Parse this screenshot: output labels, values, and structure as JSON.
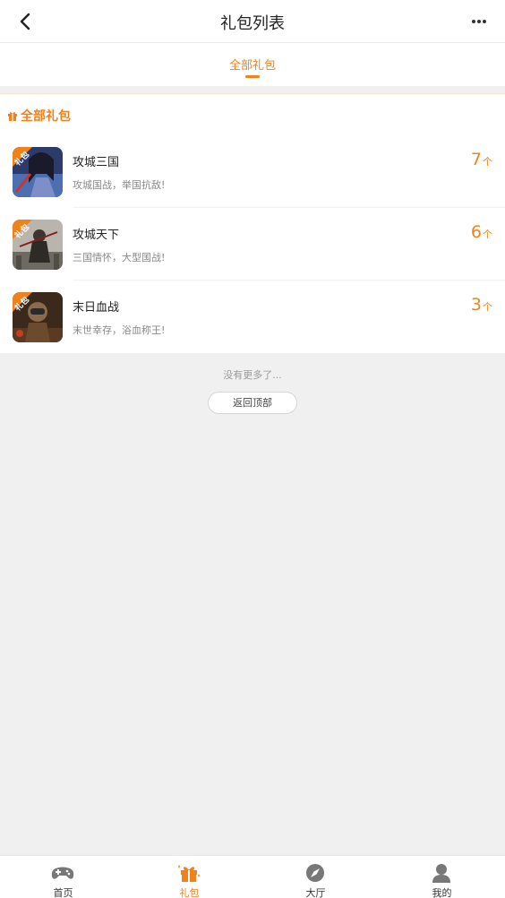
{
  "header": {
    "title": "礼包列表"
  },
  "tabs": [
    {
      "label": "全部礼包"
    }
  ],
  "section": {
    "title": "全部礼包"
  },
  "games": [
    {
      "name": "攻城三国",
      "desc": "攻城国战，举国抗敌!",
      "count": "7",
      "unit": "个",
      "badge": "礼包"
    },
    {
      "name": "攻城天下",
      "desc": "三国情怀，大型国战!",
      "count": "6",
      "unit": "个",
      "badge": "礼包"
    },
    {
      "name": "末日血战",
      "desc": "末世幸存，浴血称王!",
      "count": "3",
      "unit": "个",
      "badge": "礼包"
    }
  ],
  "footer": {
    "no_more": "没有更多了...",
    "back_top": "返回顶部"
  },
  "nav": [
    {
      "label": "首页",
      "icon": "gamepad-icon"
    },
    {
      "label": "礼包",
      "icon": "gift-icon"
    },
    {
      "label": "大厅",
      "icon": "compass-icon"
    },
    {
      "label": "我的",
      "icon": "user-icon"
    }
  ],
  "colors": {
    "accent": "#f0821e"
  }
}
